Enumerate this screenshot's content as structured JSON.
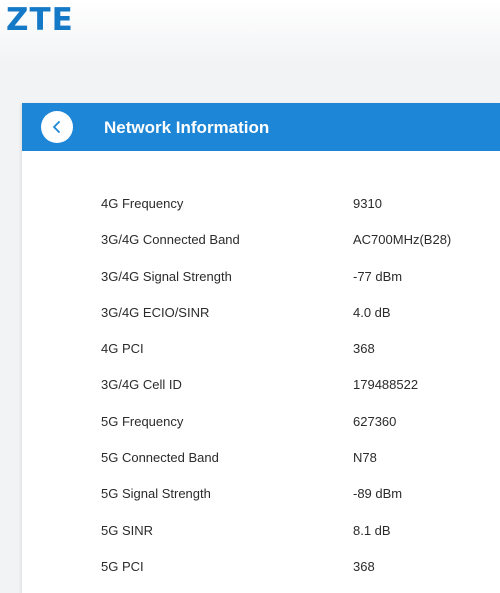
{
  "brand": {
    "logo_text": "ZTE",
    "color": "#1479c6"
  },
  "header": {
    "title": "Network Information",
    "back_icon": "chevron-left-icon",
    "accent_color": "#1e86d6"
  },
  "network_info": [
    {
      "label": "4G Frequency",
      "value": "9310"
    },
    {
      "label": "3G/4G Connected Band",
      "value": "AC700MHz(B28)"
    },
    {
      "label": "3G/4G Signal Strength",
      "value": "-77 dBm"
    },
    {
      "label": "3G/4G ECIO/SINR",
      "value": "4.0 dB"
    },
    {
      "label": "4G PCI",
      "value": "368"
    },
    {
      "label": "3G/4G Cell ID",
      "value": "179488522"
    },
    {
      "label": "5G Frequency",
      "value": "627360"
    },
    {
      "label": "5G Connected Band",
      "value": "N78"
    },
    {
      "label": "5G Signal Strength",
      "value": "-89 dBm"
    },
    {
      "label": "5G SINR",
      "value": "8.1 dB"
    },
    {
      "label": "5G PCI",
      "value": "368"
    }
  ]
}
